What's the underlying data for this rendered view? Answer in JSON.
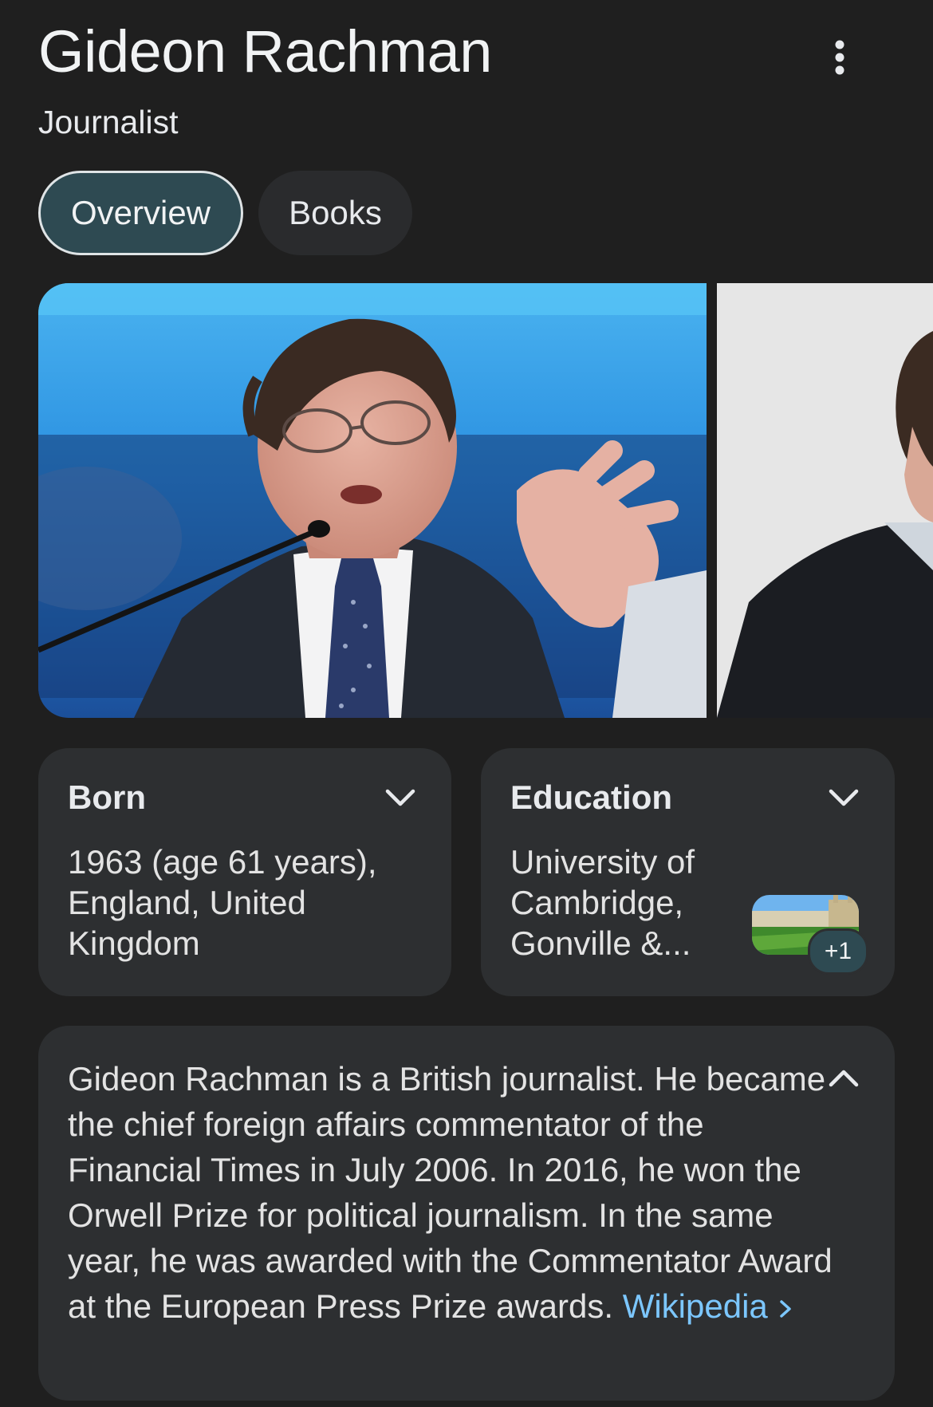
{
  "header": {
    "title": "Gideon Rachman",
    "subtitle": "Journalist",
    "more_icon": "more-vert-icon"
  },
  "tabs": [
    {
      "label": "Overview",
      "selected": true
    },
    {
      "label": "Books",
      "selected": false
    }
  ],
  "images": [
    {
      "alt": "Gideon Rachman speaking at a microphone"
    },
    {
      "alt": "Gideon Rachman portrait"
    }
  ],
  "facts": {
    "born": {
      "label": "Born",
      "value": "1963 (age 61 years),\nEngland, United\nKingdom",
      "icon": "chevron-down-icon"
    },
    "education": {
      "label": "Education",
      "value": "University of\nCambridge,\nGonville &...",
      "more_count": "+1",
      "icon": "chevron-down-icon"
    }
  },
  "description": {
    "text": "Gideon Rachman is a British journalist. He became the chief foreign affairs commentator of the Financial Times in July 2006. In 2016, he won the Orwell Prize for political journalism. In the same year, he was awarded with the Commentator Award at the European Press Prize awards.",
    "source_label": "Wikipedia",
    "source_icon": "chevron-right-icon",
    "collapse_icon": "chevron-up-icon"
  },
  "colors": {
    "background": "#1f1f1f",
    "card": "#2d2f31",
    "selected_chip": "#2e4a52",
    "link": "#7cc7ff"
  }
}
